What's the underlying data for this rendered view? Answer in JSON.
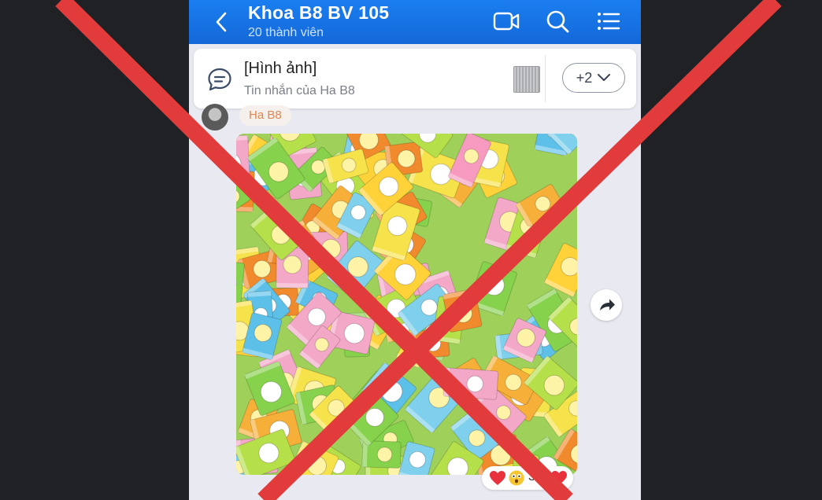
{
  "header": {
    "title": "Khoa B8 BV 105",
    "subtitle": "20 thành viên",
    "icons": [
      "back-icon",
      "video-call-icon",
      "search-icon",
      "menu-list-icon"
    ]
  },
  "pinned": {
    "title": "[Hình ảnh]",
    "subtitle": "Tin nhắn của Ha B8",
    "more_label": "+2",
    "icon": "message-icon"
  },
  "message": {
    "sender": "Ha B8",
    "image_content": "colorful wrapped candies",
    "reaction_count": "3"
  },
  "colors": {
    "header_blue": "#1a7ef0",
    "cross_red": "#e23b3b",
    "chat_background": "#e9eaf1"
  }
}
